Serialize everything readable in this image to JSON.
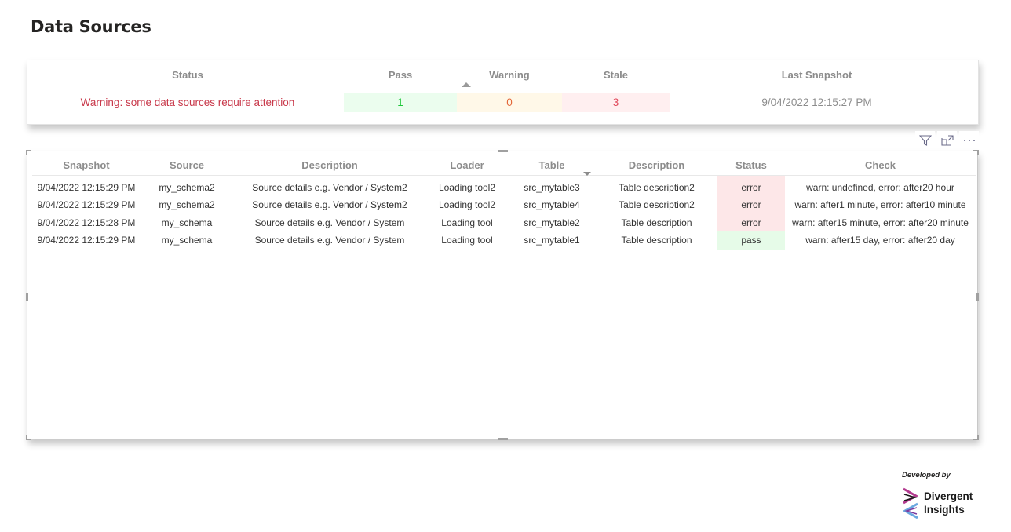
{
  "page": {
    "title": "Data Sources"
  },
  "kpi": {
    "status": {
      "label": "Status",
      "value": "Warning: some data sources require attention"
    },
    "pass": {
      "label": "Pass",
      "value": "1"
    },
    "warning": {
      "label": "Warning",
      "value": "0"
    },
    "stale": {
      "label": "Stale",
      "value": "3"
    },
    "last_snapshot": {
      "label": "Last Snapshot",
      "value": "9/04/2022 12:15:27 PM"
    },
    "colors": {
      "status_text": "#c8384a",
      "pass": "#1fc83c",
      "warning": "#e3683a",
      "stale": "#e0485a"
    }
  },
  "visual_header": {
    "icons": [
      "filter-icon",
      "focus-mode-icon",
      "more-options-icon"
    ]
  },
  "table": {
    "columns": [
      "Snapshot",
      "Source",
      "Description",
      "Loader",
      "Table",
      "Description",
      "Status",
      "Check"
    ],
    "rows": [
      {
        "snapshot": "9/04/2022 12:15:29 PM",
        "source": "my_schema2",
        "source_description": "Source details e.g. Vendor / System2",
        "loader": "Loading tool2",
        "table": "src_mytable3",
        "table_description": "Table description2",
        "status": "error",
        "check": "warn: undefined, error: after20 hour"
      },
      {
        "snapshot": "9/04/2022 12:15:29 PM",
        "source": "my_schema2",
        "source_description": "Source details e.g. Vendor / System2",
        "loader": "Loading tool2",
        "table": "src_mytable4",
        "table_description": "Table description2",
        "status": "error",
        "check": "warn: after1 minute, error: after10 minute"
      },
      {
        "snapshot": "9/04/2022 12:15:28 PM",
        "source": "my_schema",
        "source_description": "Source details e.g. Vendor / System",
        "loader": "Loading tool",
        "table": "src_mytable2",
        "table_description": "Table description",
        "status": "error",
        "check": "warn: after15 minute, error: after20 minute"
      },
      {
        "snapshot": "9/04/2022 12:15:29 PM",
        "source": "my_schema",
        "source_description": "Source details e.g. Vendor / System",
        "loader": "Loading tool",
        "table": "src_mytable1",
        "table_description": "Table description",
        "status": "pass",
        "check": "warn: after15 day, error: after20 day"
      }
    ]
  },
  "footer": {
    "developed_by": "Developed by",
    "brand_line1": "Divergent",
    "brand_line2": "Insights"
  }
}
